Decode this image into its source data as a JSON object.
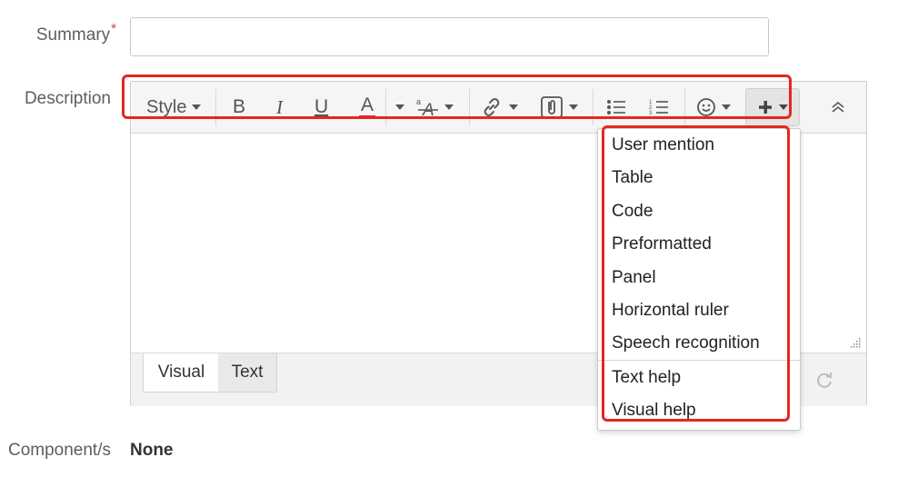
{
  "form": {
    "summary_label": "Summary",
    "required_marker": "*",
    "summary_value": "",
    "description_label": "Description",
    "component_label": "Component/s",
    "component_value": "None"
  },
  "toolbar": {
    "style_label": "Style",
    "bold": "B",
    "italic": "I",
    "underline": "U",
    "text_color": "A",
    "icons": [
      "caret-down-icon",
      "text-effects-icon",
      "link-icon",
      "attachment-icon",
      "bullet-list-icon",
      "numbered-list-icon",
      "emoji-icon",
      "plus-icon",
      "collapse-icon"
    ]
  },
  "editor": {
    "tabs": [
      {
        "label": "Visual",
        "selected": true
      },
      {
        "label": "Text",
        "selected": false
      }
    ],
    "content": ""
  },
  "insert_menu": {
    "items": [
      {
        "label": "User mention"
      },
      {
        "label": "Table"
      },
      {
        "label": "Code"
      },
      {
        "label": "Preformatted"
      },
      {
        "label": "Panel"
      },
      {
        "label": "Horizontal ruler"
      },
      {
        "label": "Speech recognition"
      }
    ],
    "help_items": [
      {
        "label": "Text help"
      },
      {
        "label": "Visual help"
      }
    ]
  },
  "colors": {
    "highlight": "#e5271f",
    "required": "#d04437"
  }
}
